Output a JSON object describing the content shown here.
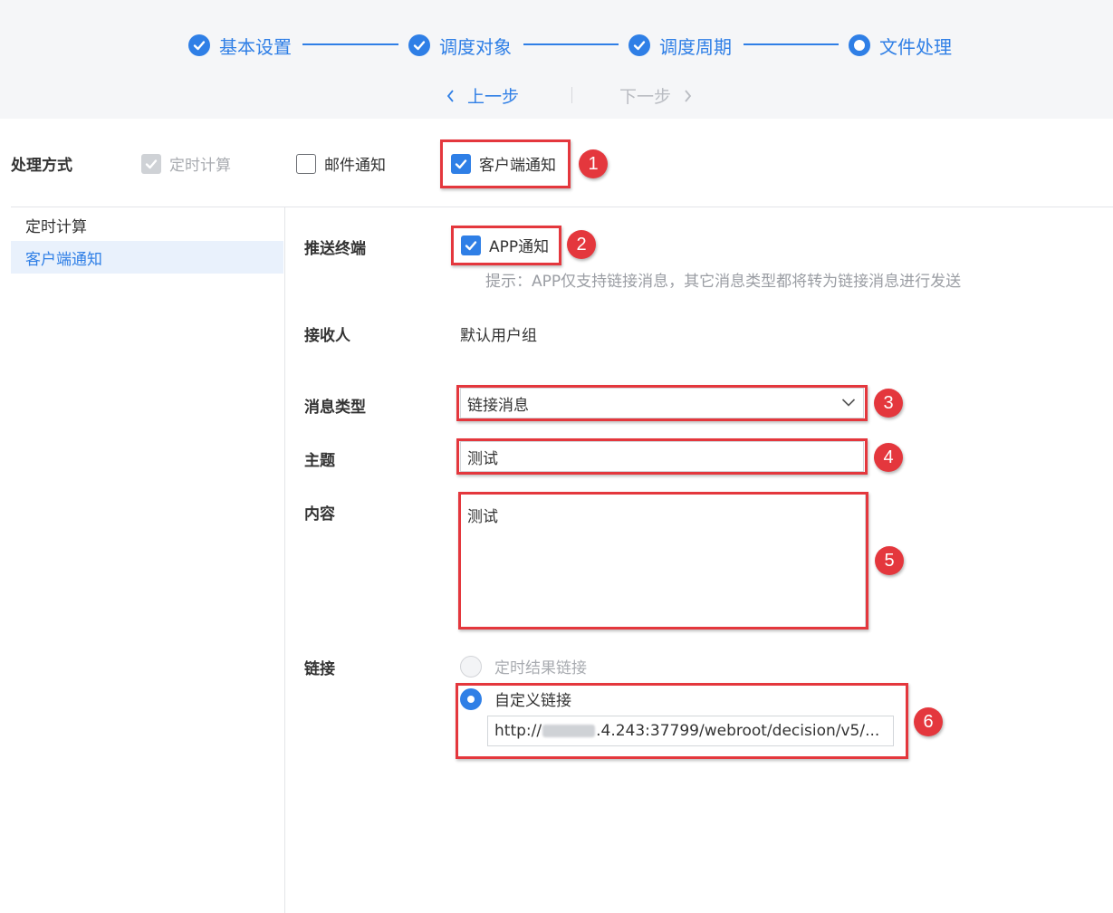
{
  "steps": [
    {
      "label": "基本设置",
      "state": "done"
    },
    {
      "label": "调度对象",
      "state": "done"
    },
    {
      "label": "调度周期",
      "state": "done"
    },
    {
      "label": "文件处理",
      "state": "current"
    }
  ],
  "nav": {
    "prev": "上一步",
    "next": "下一步"
  },
  "method": {
    "title": "处理方式",
    "options": [
      {
        "label": "定时计算",
        "checked": true,
        "disabled": true
      },
      {
        "label": "邮件通知",
        "checked": false,
        "disabled": false
      },
      {
        "label": "客户端通知",
        "checked": true,
        "disabled": false
      }
    ]
  },
  "sidebar": {
    "items": [
      "定时计算",
      "客户端通知"
    ],
    "active": "客户端通知"
  },
  "form": {
    "push_label": "推送终端",
    "app_notify": "APP通知",
    "hint": "提示：APP仅支持链接消息，其它消息类型都将转为链接消息进行发送",
    "receiver_label": "接收人",
    "receiver_value": "默认用户组",
    "msgtype_label": "消息类型",
    "msgtype_value": "链接消息",
    "subject_label": "主题",
    "subject_value": "测试",
    "content_label": "内容",
    "content_value": "测试",
    "link_label": "链接",
    "link_opt1": "定时结果链接",
    "link_opt2": "自定义链接",
    "url_prefix": "http://",
    "url_suffix": ".4.243:37799/webroot/decision/v5/..."
  },
  "annotations": [
    "1",
    "2",
    "3",
    "4",
    "5",
    "6"
  ],
  "colors": {
    "accent": "#2f7fe6",
    "annotation": "#e4373d",
    "disabled": "#a8abb0"
  },
  "icons": [
    "check-icon",
    "chevron-left-icon",
    "chevron-right-icon",
    "chevron-down-icon",
    "radio-dot-icon"
  ]
}
